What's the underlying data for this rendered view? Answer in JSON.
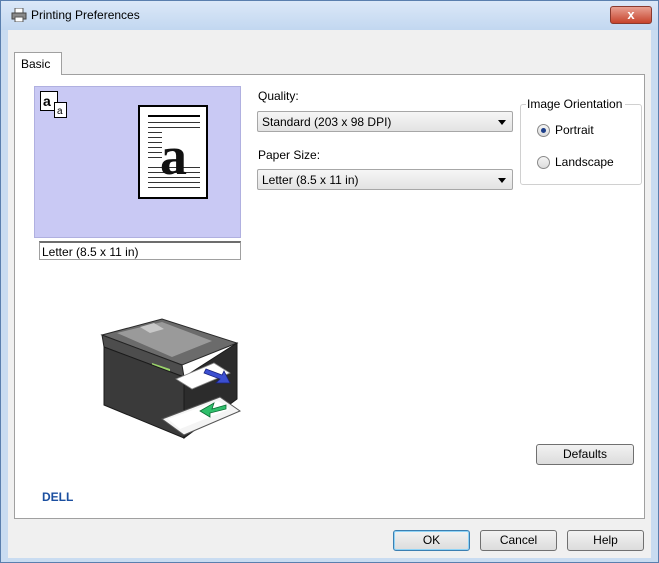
{
  "window": {
    "title": "Printing Preferences",
    "close_label": "x"
  },
  "tabs": [
    {
      "label": "Basic",
      "selected": true
    }
  ],
  "preview": {
    "paper_label": "Letter (8.5 x 11 in)",
    "page_glyph": "a"
  },
  "quality": {
    "label": "Quality:",
    "value": "Standard (203 x 98 DPI)"
  },
  "paper_size": {
    "label": "Paper Size:",
    "value": "Letter (8.5 x 11 in)"
  },
  "orientation": {
    "title": "Image Orientation",
    "options": [
      {
        "label": "Portrait",
        "checked": true
      },
      {
        "label": "Landscape",
        "checked": false
      }
    ]
  },
  "brand": {
    "logo_text": "DELL"
  },
  "buttons": {
    "defaults": "Defaults",
    "ok": "OK",
    "cancel": "Cancel",
    "help": "Help"
  },
  "colors": {
    "preview_bg": "#c9c9f4",
    "title_bar": "#c2d7f0",
    "close_button": "#c7432c",
    "dell_blue": "#1b4fa0"
  }
}
